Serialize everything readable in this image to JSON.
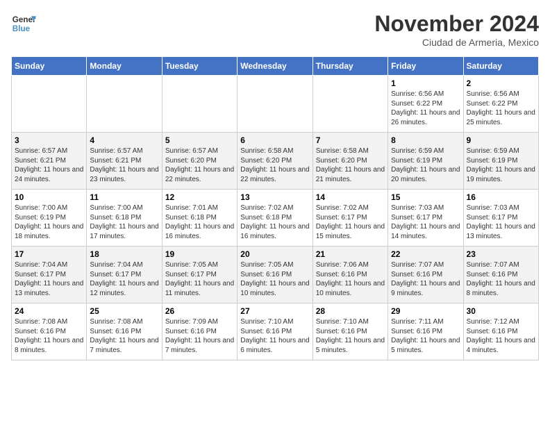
{
  "header": {
    "logo_line1": "General",
    "logo_line2": "Blue",
    "month_title": "November 2024",
    "subtitle": "Ciudad de Armeria, Mexico"
  },
  "weekdays": [
    "Sunday",
    "Monday",
    "Tuesday",
    "Wednesday",
    "Thursday",
    "Friday",
    "Saturday"
  ],
  "weeks": [
    [
      {
        "day": "",
        "info": ""
      },
      {
        "day": "",
        "info": ""
      },
      {
        "day": "",
        "info": ""
      },
      {
        "day": "",
        "info": ""
      },
      {
        "day": "",
        "info": ""
      },
      {
        "day": "1",
        "info": "Sunrise: 6:56 AM\nSunset: 6:22 PM\nDaylight: 11 hours and 26 minutes."
      },
      {
        "day": "2",
        "info": "Sunrise: 6:56 AM\nSunset: 6:22 PM\nDaylight: 11 hours and 25 minutes."
      }
    ],
    [
      {
        "day": "3",
        "info": "Sunrise: 6:57 AM\nSunset: 6:21 PM\nDaylight: 11 hours and 24 minutes."
      },
      {
        "day": "4",
        "info": "Sunrise: 6:57 AM\nSunset: 6:21 PM\nDaylight: 11 hours and 23 minutes."
      },
      {
        "day": "5",
        "info": "Sunrise: 6:57 AM\nSunset: 6:20 PM\nDaylight: 11 hours and 22 minutes."
      },
      {
        "day": "6",
        "info": "Sunrise: 6:58 AM\nSunset: 6:20 PM\nDaylight: 11 hours and 22 minutes."
      },
      {
        "day": "7",
        "info": "Sunrise: 6:58 AM\nSunset: 6:20 PM\nDaylight: 11 hours and 21 minutes."
      },
      {
        "day": "8",
        "info": "Sunrise: 6:59 AM\nSunset: 6:19 PM\nDaylight: 11 hours and 20 minutes."
      },
      {
        "day": "9",
        "info": "Sunrise: 6:59 AM\nSunset: 6:19 PM\nDaylight: 11 hours and 19 minutes."
      }
    ],
    [
      {
        "day": "10",
        "info": "Sunrise: 7:00 AM\nSunset: 6:19 PM\nDaylight: 11 hours and 18 minutes."
      },
      {
        "day": "11",
        "info": "Sunrise: 7:00 AM\nSunset: 6:18 PM\nDaylight: 11 hours and 17 minutes."
      },
      {
        "day": "12",
        "info": "Sunrise: 7:01 AM\nSunset: 6:18 PM\nDaylight: 11 hours and 16 minutes."
      },
      {
        "day": "13",
        "info": "Sunrise: 7:02 AM\nSunset: 6:18 PM\nDaylight: 11 hours and 16 minutes."
      },
      {
        "day": "14",
        "info": "Sunrise: 7:02 AM\nSunset: 6:17 PM\nDaylight: 11 hours and 15 minutes."
      },
      {
        "day": "15",
        "info": "Sunrise: 7:03 AM\nSunset: 6:17 PM\nDaylight: 11 hours and 14 minutes."
      },
      {
        "day": "16",
        "info": "Sunrise: 7:03 AM\nSunset: 6:17 PM\nDaylight: 11 hours and 13 minutes."
      }
    ],
    [
      {
        "day": "17",
        "info": "Sunrise: 7:04 AM\nSunset: 6:17 PM\nDaylight: 11 hours and 13 minutes."
      },
      {
        "day": "18",
        "info": "Sunrise: 7:04 AM\nSunset: 6:17 PM\nDaylight: 11 hours and 12 minutes."
      },
      {
        "day": "19",
        "info": "Sunrise: 7:05 AM\nSunset: 6:17 PM\nDaylight: 11 hours and 11 minutes."
      },
      {
        "day": "20",
        "info": "Sunrise: 7:05 AM\nSunset: 6:16 PM\nDaylight: 11 hours and 10 minutes."
      },
      {
        "day": "21",
        "info": "Sunrise: 7:06 AM\nSunset: 6:16 PM\nDaylight: 11 hours and 10 minutes."
      },
      {
        "day": "22",
        "info": "Sunrise: 7:07 AM\nSunset: 6:16 PM\nDaylight: 11 hours and 9 minutes."
      },
      {
        "day": "23",
        "info": "Sunrise: 7:07 AM\nSunset: 6:16 PM\nDaylight: 11 hours and 8 minutes."
      }
    ],
    [
      {
        "day": "24",
        "info": "Sunrise: 7:08 AM\nSunset: 6:16 PM\nDaylight: 11 hours and 8 minutes."
      },
      {
        "day": "25",
        "info": "Sunrise: 7:08 AM\nSunset: 6:16 PM\nDaylight: 11 hours and 7 minutes."
      },
      {
        "day": "26",
        "info": "Sunrise: 7:09 AM\nSunset: 6:16 PM\nDaylight: 11 hours and 7 minutes."
      },
      {
        "day": "27",
        "info": "Sunrise: 7:10 AM\nSunset: 6:16 PM\nDaylight: 11 hours and 6 minutes."
      },
      {
        "day": "28",
        "info": "Sunrise: 7:10 AM\nSunset: 6:16 PM\nDaylight: 11 hours and 5 minutes."
      },
      {
        "day": "29",
        "info": "Sunrise: 7:11 AM\nSunset: 6:16 PM\nDaylight: 11 hours and 5 minutes."
      },
      {
        "day": "30",
        "info": "Sunrise: 7:12 AM\nSunset: 6:16 PM\nDaylight: 11 hours and 4 minutes."
      }
    ]
  ]
}
